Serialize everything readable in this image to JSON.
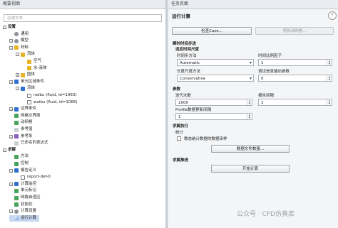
{
  "left_panel": {
    "title": "概要视图",
    "filter_placeholder": "过滤文本",
    "tree": [
      {
        "label": "设置",
        "level": 0,
        "section": true,
        "expander": "−"
      },
      {
        "label": "通用",
        "level": 1,
        "icon": "ic-gear"
      },
      {
        "label": "模型",
        "level": 1,
        "icon": "ic-gear",
        "expander": "+"
      },
      {
        "label": "材料",
        "level": 1,
        "icon": "ic-yellow",
        "expander": "−"
      },
      {
        "label": "流体",
        "level": 2,
        "icon": "ic-yellow",
        "expander": "−"
      },
      {
        "label": "空气",
        "level": 3,
        "icon": "ic-yellow"
      },
      {
        "label": "水-液体",
        "level": 3,
        "icon": "ic-yellow"
      },
      {
        "label": "固体",
        "level": 2,
        "icon": "ic-yellow",
        "expander": "+"
      },
      {
        "label": "单元区域条件",
        "level": 1,
        "icon": "ic-blue",
        "expander": "−"
      },
      {
        "label": "流体",
        "level": 2,
        "icon": "ic-blue",
        "expander": "−"
      },
      {
        "label": "neibu (fluid, id=1063)",
        "level": 3,
        "icon": "ic-check"
      },
      {
        "label": "waibu (fluid, id=1066)",
        "level": 3,
        "icon": "ic-check"
      },
      {
        "label": "边界条件",
        "level": 1,
        "icon": "ic-blue",
        "expander": "+"
      },
      {
        "label": "网格交界面",
        "level": 1,
        "icon": "ic-green"
      },
      {
        "label": "动网格",
        "level": 1,
        "icon": "ic-green"
      },
      {
        "label": "参考值",
        "level": 1,
        "icon": "ic-gray"
      },
      {
        "label": "参考系",
        "level": 1,
        "icon": "ic-purple",
        "expander": "+"
      },
      {
        "label": "已命名的表达式",
        "level": 1,
        "icon": "ic-gray"
      },
      {
        "label": "求解",
        "level": 0,
        "section": true,
        "expander": "−"
      },
      {
        "label": "方法",
        "level": 1,
        "icon": "ic-green"
      },
      {
        "label": "控制",
        "level": 1,
        "icon": "ic-green"
      },
      {
        "label": "报告定义",
        "level": 1,
        "icon": "ic-blue",
        "expander": "−"
      },
      {
        "label": "report-def-0",
        "level": 2,
        "icon": "ic-check"
      },
      {
        "label": "计算监控",
        "level": 1,
        "icon": "ic-blue",
        "expander": "+"
      },
      {
        "label": "单元标记",
        "level": 1,
        "icon": "ic-green"
      },
      {
        "label": "网格自适应",
        "level": 1,
        "icon": "ic-green"
      },
      {
        "label": "初始化",
        "level": 1,
        "icon": "ic-green"
      },
      {
        "label": "计算设置",
        "level": 1,
        "icon": "ic-gear",
        "expander": "+"
      },
      {
        "label": "运行计算",
        "level": 1,
        "icon": "ic-sphere",
        "selected": true
      }
    ]
  },
  "right_panel": {
    "title": "任务页面",
    "heading": "运行计算",
    "help_glyph": "?",
    "check_case_label": "检查Case...",
    "update_dynamic_mesh_label": "更新动网格...",
    "time_advancement_section": "瞬时时间步进",
    "adaptive_time_heading": "适应时间尺度",
    "time_step_method_label": "时间步方法",
    "time_step_method_value": "Automatic",
    "time_scale_factor_label": "时间比例因子",
    "time_scale_factor_value": "1",
    "length_scale_method_label": "长度尺度方法",
    "length_scale_method_value": "Conservative",
    "verbosity_label": "调试信息输出参数",
    "verbosity_value": "0",
    "parameters_section": "参数",
    "iterations_label": "迭代次数",
    "iterations_value": "1000",
    "reporting_interval_label": "报告间隔",
    "reporting_interval_value": "1",
    "profile_update_label": "Profile数据更新间隔",
    "profile_update_value": "1",
    "solution_processing_section": "求解执行",
    "statistics_label": "统计",
    "data_sampling_label": "稳态统计数据的数据采样",
    "data_file_quantities_label": "数据文件数量...",
    "solution_advancement_section": "求解推进",
    "calculate_label": "开始计算"
  },
  "watermark": "公众号 · CFD仿真库"
}
